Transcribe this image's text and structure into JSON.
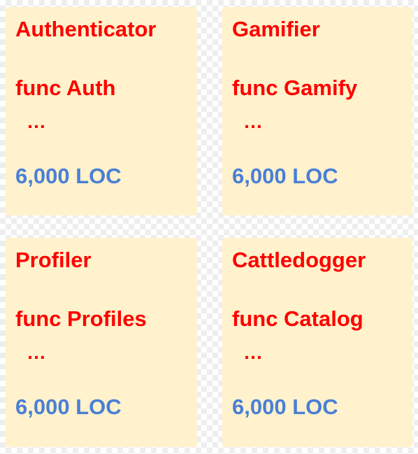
{
  "cards": [
    {
      "title": "Authenticator",
      "func": "func Auth",
      "ellipsis": "…",
      "loc": "6,000 LOC"
    },
    {
      "title": "Gamifier",
      "func": "func Gamify",
      "ellipsis": "…",
      "loc": "6,000 LOC"
    },
    {
      "title": "Profiler",
      "func": "func Profiles",
      "ellipsis": "…",
      "loc": "6,000 LOC"
    },
    {
      "title": "Cattledogger",
      "func": "func Catalog",
      "ellipsis": "…",
      "loc": "6,000 LOC"
    }
  ],
  "colors": {
    "card_background": "#fff2cc",
    "title_text": "#ff0000",
    "loc_text": "#4a7fd6"
  }
}
